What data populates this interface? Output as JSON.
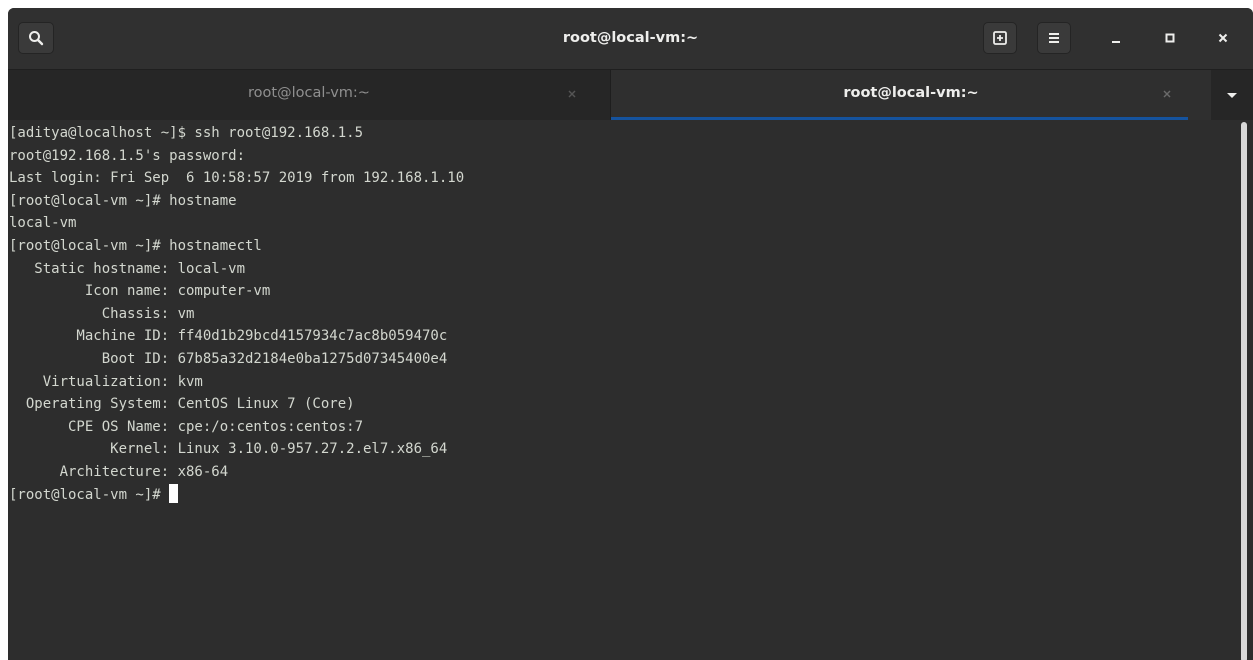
{
  "window": {
    "title": "root@local-vm:~"
  },
  "headerbar": {
    "search_icon": "search-icon",
    "new_tab_icon": "new-tab-icon",
    "menu_icon": "hamburger-menu-icon",
    "minimize_icon": "minimize-icon",
    "maximize_icon": "maximize-icon",
    "close_icon": "close-icon"
  },
  "tabs": [
    {
      "label": "root@local-vm:~",
      "active": false
    },
    {
      "label": "root@local-vm:~",
      "active": true
    }
  ],
  "terminal": {
    "lines": [
      "[aditya@localhost ~]$ ssh root@192.168.1.5",
      "root@192.168.1.5's password:",
      "Last login: Fri Sep  6 10:58:57 2019 from 192.168.1.10",
      "[root@local-vm ~]# hostname",
      "local-vm",
      "[root@local-vm ~]# hostnamectl",
      "   Static hostname: local-vm",
      "         Icon name: computer-vm",
      "           Chassis: vm",
      "        Machine ID: ff40d1b29bcd4157934c7ac8b059470c",
      "           Boot ID: 67b85a32d2184e0ba1275d07345400e4",
      "    Virtualization: kvm",
      "  Operating System: CentOS Linux 7 (Core)",
      "       CPE OS Name: cpe:/o:centos:centos:7",
      "            Kernel: Linux 3.10.0-957.27.2.el7.x86_64",
      "      Architecture: x86-64"
    ],
    "prompt": "[root@local-vm ~]# "
  },
  "colors": {
    "accent": "#15539e",
    "terminal_bg": "#2d2d2d",
    "terminal_fg": "#d3d7cf"
  }
}
